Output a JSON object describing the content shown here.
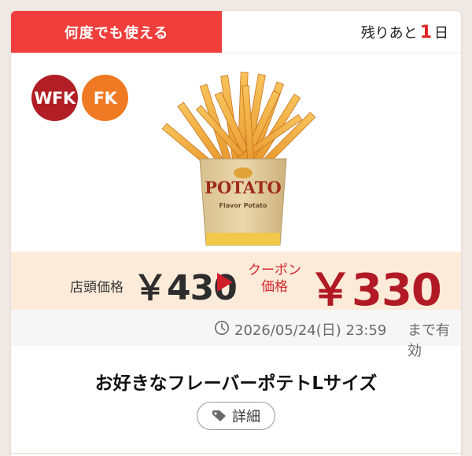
{
  "coupon": {
    "banner_text": "何度でも使える",
    "remaining_prefix": "残りあと",
    "remaining_days": "1",
    "remaining_suffix": "日",
    "badges": [
      "WFK",
      "FK"
    ],
    "product_box_text": "POTATO",
    "product_box_subtext": "Flavor Potato",
    "store_price_label": "店頭価格",
    "store_price": "￥430",
    "coupon_price_label_line1": "クーポン",
    "coupon_price_label_line2": "価格",
    "coupon_price": "￥330",
    "expiry_date": "2026/05/24(日) 23:59",
    "expiry_suffix": "まで有効",
    "title": "お好きなフレーバーポテトLサイズ",
    "detail_button": "詳細"
  },
  "icons": {
    "clock": "clock-icon",
    "tag": "tag-icon"
  },
  "colors": {
    "banner": "#ef3e3c",
    "wfk_badge": "#b11e25",
    "fk_badge": "#f07923",
    "price_band": "#fcebd9",
    "coupon_price": "#b11a25"
  }
}
